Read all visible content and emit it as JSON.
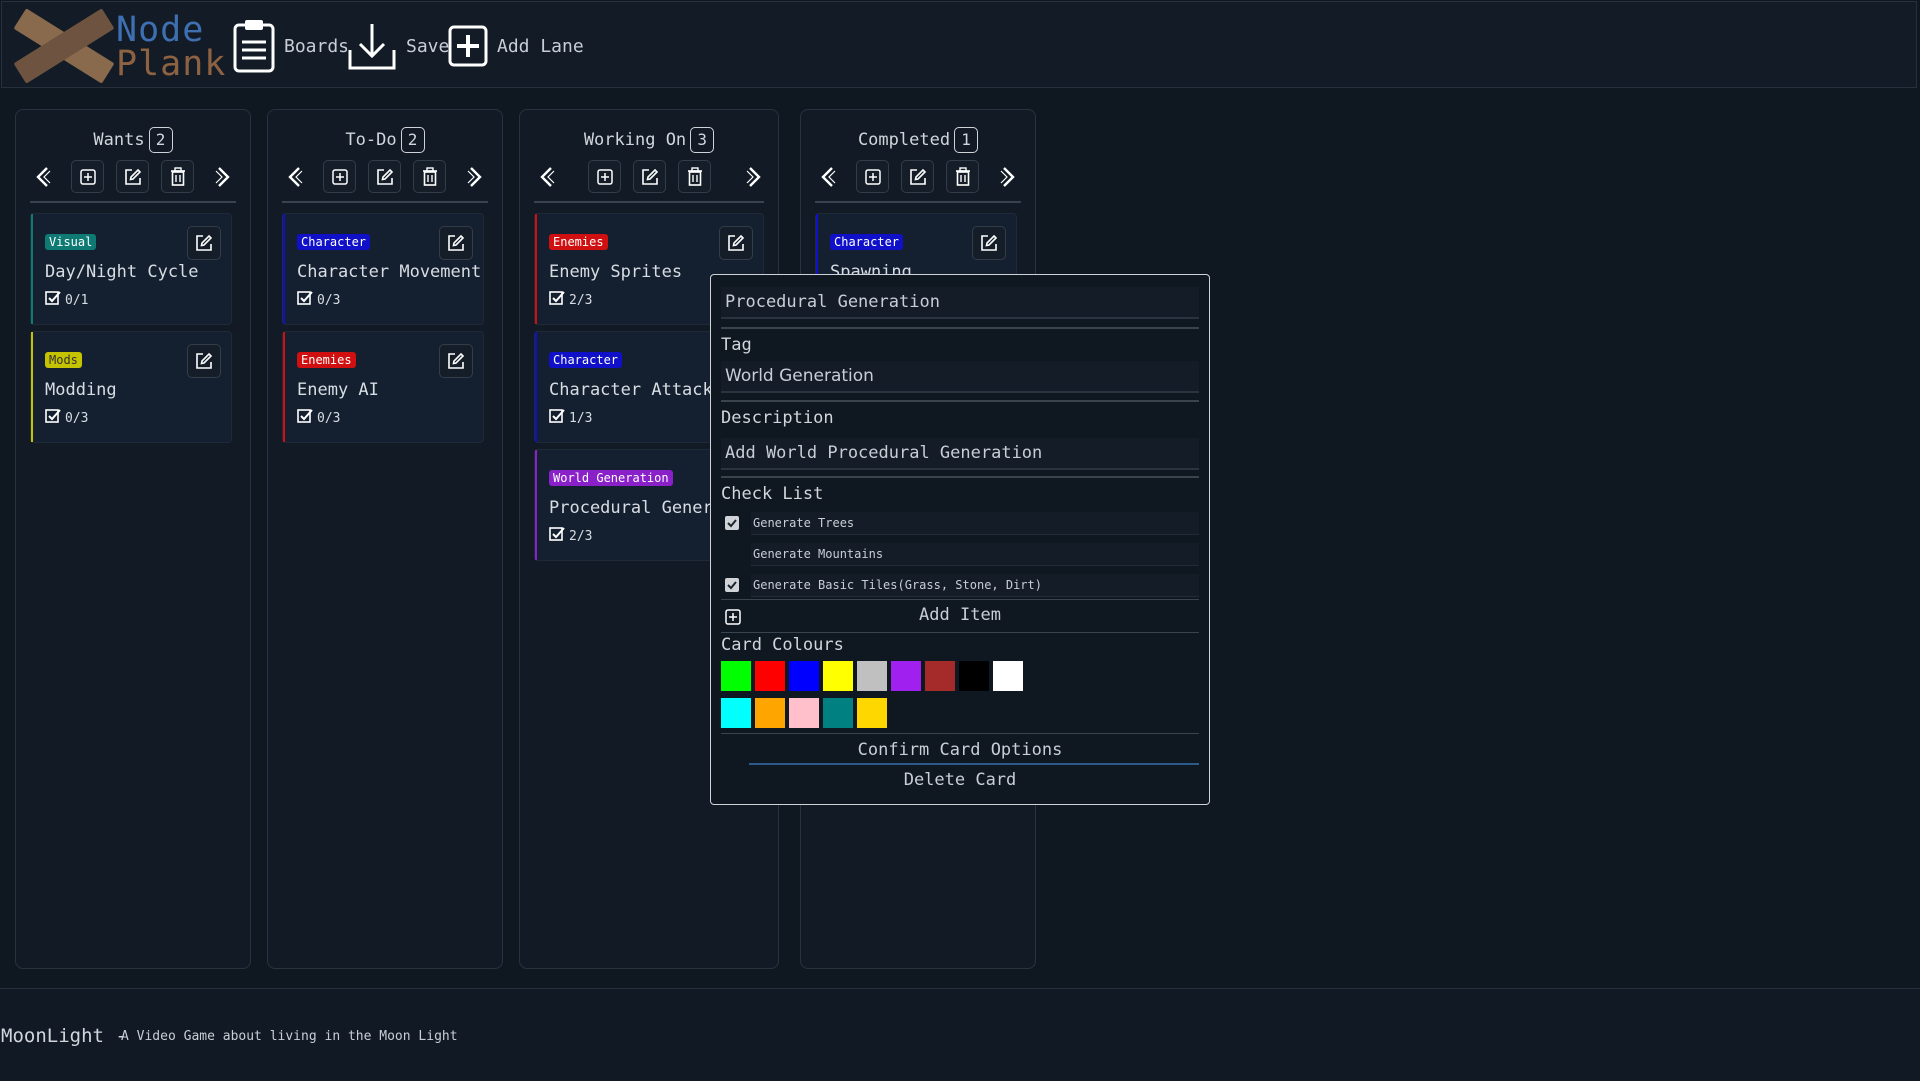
{
  "app": {
    "logo_line1": "Node",
    "logo_line2": "Plank"
  },
  "toolbar": {
    "boards_label": "Boards",
    "save_label": "Save",
    "add_lane_label": "Add Lane"
  },
  "lanes": [
    {
      "title": "Wants",
      "count": "2",
      "cards": [
        {
          "tag": "Visual",
          "tag_color": "#0e7a73",
          "title": "Day/Night Cycle",
          "progress": "0/1",
          "color": "#0e7a73"
        },
        {
          "tag": "Mods",
          "tag_color": "#c5c200",
          "title": "Modding",
          "progress": "0/3",
          "color": "#c5c200"
        }
      ]
    },
    {
      "title": "To-Do",
      "count": "2",
      "cards": [
        {
          "tag": "Character",
          "tag_color": "#1010c8",
          "title": "Character Movement",
          "progress": "0/3",
          "color": "#1010c8"
        },
        {
          "tag": "Enemies",
          "tag_color": "#d01010",
          "title": "Enemy AI",
          "progress": "0/3",
          "color": "#d01010"
        }
      ]
    },
    {
      "title": "Working On",
      "count": "3",
      "cards": [
        {
          "tag": "Enemies",
          "tag_color": "#d01010",
          "title": "Enemy Sprites",
          "progress": "2/3",
          "color": "#d01010"
        },
        {
          "tag": "Character",
          "tag_color": "#1010c8",
          "title": "Character Attacks",
          "progress": "1/3",
          "color": "#1010c8"
        },
        {
          "tag": "World Generation",
          "tag_color": "#8a20c8",
          "title": "Procedural Generation",
          "progress": "2/3",
          "color": "#8a20c8"
        }
      ]
    },
    {
      "title": "Completed",
      "count": "1",
      "cards": [
        {
          "tag": "Character",
          "tag_color": "#1010c8",
          "title": "Spawning",
          "progress": "",
          "color": "#1010c8"
        }
      ]
    }
  ],
  "modal": {
    "title_value": "Procedural Generation",
    "tag_label": "Tag",
    "tag_value": "World Generation",
    "description_label": "Description",
    "description_value": "Add World Procedural Generation",
    "checklist_label": "Check List",
    "checklist": [
      {
        "text": "Generate Trees",
        "checked": true
      },
      {
        "text": "Generate Mountains",
        "checked": false
      },
      {
        "text": "Generate Basic Tiles(Grass, Stone, Dirt)",
        "checked": true
      }
    ],
    "add_item_label": "Add Item",
    "colours_label": "Card Colours",
    "colours": [
      "#00ff00",
      "#ff0000",
      "#0000ff",
      "#ffff00",
      "#c0c0c0",
      "#a020f0",
      "#a52a2a",
      "#000000",
      "#ffffff",
      "#00ffff",
      "#ffa500",
      "#ffc0cb",
      "#008080",
      "#ffd700"
    ],
    "confirm_label": "Confirm Card Options",
    "delete_label": "Delete Card"
  },
  "footer": {
    "project": "MoonLight -",
    "description": "A Video Game about living in the Moon Light"
  }
}
